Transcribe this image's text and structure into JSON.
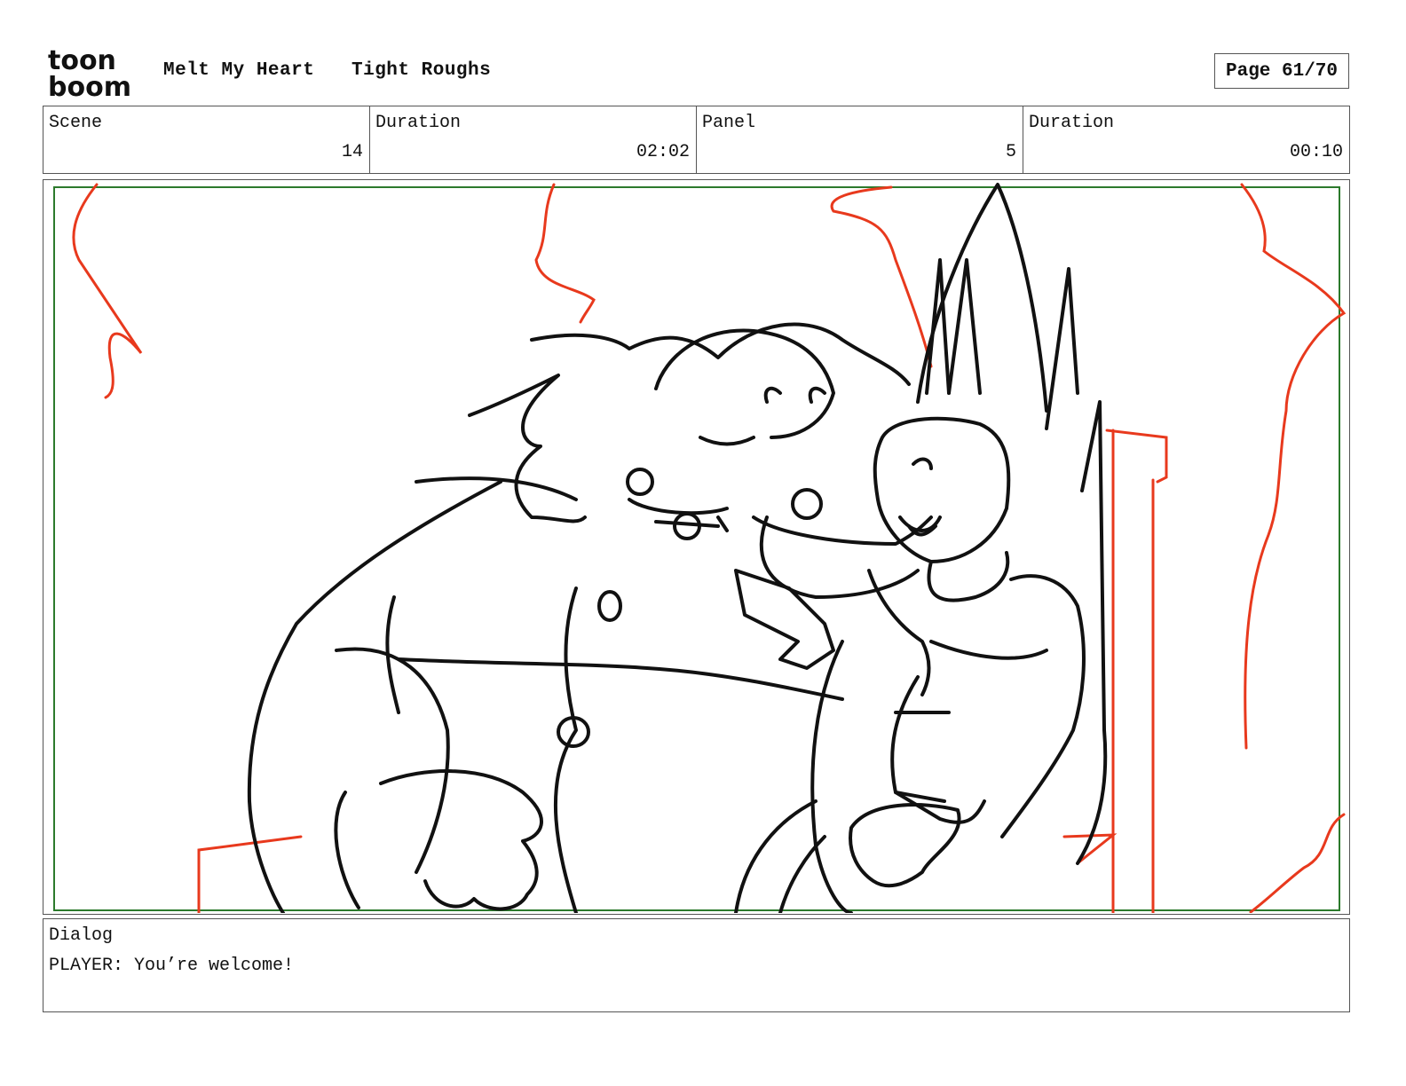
{
  "header": {
    "logo_line1": "toon",
    "logo_line2": "boom",
    "project": "Melt My Heart",
    "stage": "Tight Roughs",
    "page": "Page 61/70"
  },
  "info": {
    "scene_label": "Scene",
    "scene_value": "14",
    "scene_duration_label": "Duration",
    "scene_duration_value": "02:02",
    "panel_label": "Panel",
    "panel_value": "5",
    "panel_duration_label": "Duration",
    "panel_duration_value": "00:10"
  },
  "dialog": {
    "label": "Dialog",
    "text": "PLAYER: You’re welcome!"
  },
  "colors": {
    "border": "#555555",
    "safe_frame": "#2c7a2c",
    "sketch_red": "#e8391d",
    "ink": "#111111"
  }
}
